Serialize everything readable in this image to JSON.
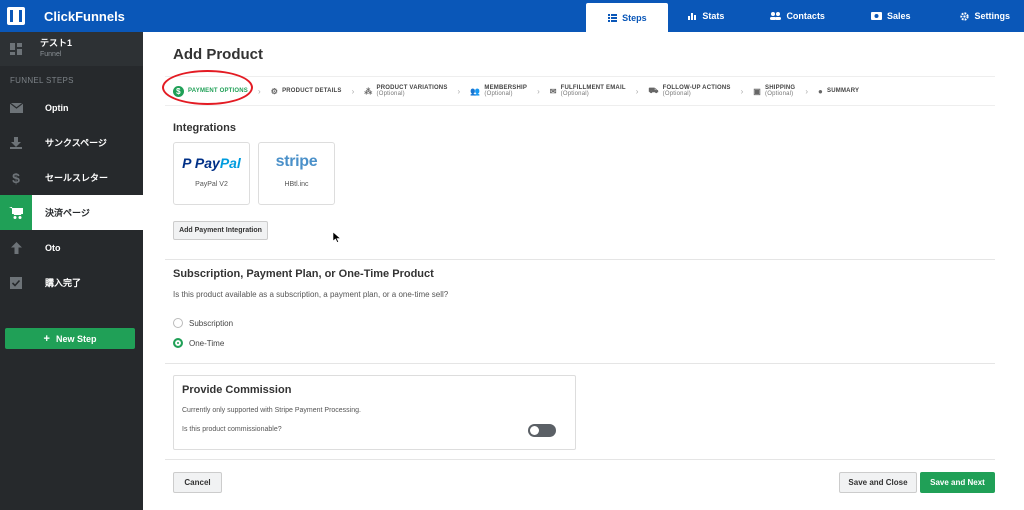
{
  "app": {
    "brand": "ClickFunnels"
  },
  "topnav": {
    "items": [
      {
        "label": "Steps",
        "icon": "list-icon"
      },
      {
        "label": "Stats",
        "icon": "bar-chart-icon"
      },
      {
        "label": "Contacts",
        "icon": "users-icon"
      },
      {
        "label": "Sales",
        "icon": "money-icon"
      },
      {
        "label": "Settings",
        "icon": "gear-icon"
      }
    ]
  },
  "sidebar": {
    "funnel_name": "テスト1",
    "funnel_type": "Funnel",
    "steps_heading": "FUNNEL STEPS",
    "steps": [
      {
        "label": "Optin",
        "icon": "envelope-icon"
      },
      {
        "label": "サンクスページ",
        "icon": "download-icon"
      },
      {
        "label": "セールスレター",
        "icon": "dollar-icon"
      },
      {
        "label": "決済ページ",
        "icon": "cart-icon"
      },
      {
        "label": "Oto",
        "icon": "arrow-up-icon"
      },
      {
        "label": "購入完了",
        "icon": "check-icon"
      }
    ],
    "new_step": "New Step"
  },
  "main": {
    "title": "Add Product",
    "wizard": [
      {
        "label": "PAYMENT OPTIONS",
        "sub": ""
      },
      {
        "label": "PRODUCT DETAILS",
        "sub": ""
      },
      {
        "label": "PRODUCT VARIATIONS",
        "sub": "(Optional)"
      },
      {
        "label": "MEMBERSHIP",
        "sub": "(Optional)"
      },
      {
        "label": "FULFILLMENT EMAIL",
        "sub": "(Optional)"
      },
      {
        "label": "FOLLOW-UP ACTIONS",
        "sub": "(Optional)"
      },
      {
        "label": "SHIPPING",
        "sub": "(Optional)"
      },
      {
        "label": "SUMMARY",
        "sub": ""
      }
    ],
    "integrations": {
      "heading": "Integrations",
      "cards": [
        {
          "logo_a": "Pay",
          "logo_b": "Pal",
          "label": "PayPal V2"
        },
        {
          "logo": "stripe",
          "label": "HBtl.inc"
        }
      ],
      "add_button": "Add Payment Integration"
    },
    "subscription": {
      "heading": "Subscription, Payment Plan, or One-Time Product",
      "question": "Is this product available as a subscription, a payment plan, or a one-time sell?",
      "options": [
        {
          "label": "Subscription",
          "selected": false
        },
        {
          "label": "One-Time",
          "selected": true
        }
      ]
    },
    "commission": {
      "heading": "Provide Commission",
      "description": "Currently only supported with Stripe Payment Processing.",
      "question": "Is this product commissionable?",
      "enabled": false
    },
    "footer": {
      "cancel": "Cancel",
      "save_close": "Save and Close",
      "save_next": "Save and Next"
    }
  },
  "colors": {
    "topbar": "#0a57b8",
    "sidebar": "#26292c",
    "accent_green": "#20a057",
    "highlight_red": "#e31b23"
  }
}
